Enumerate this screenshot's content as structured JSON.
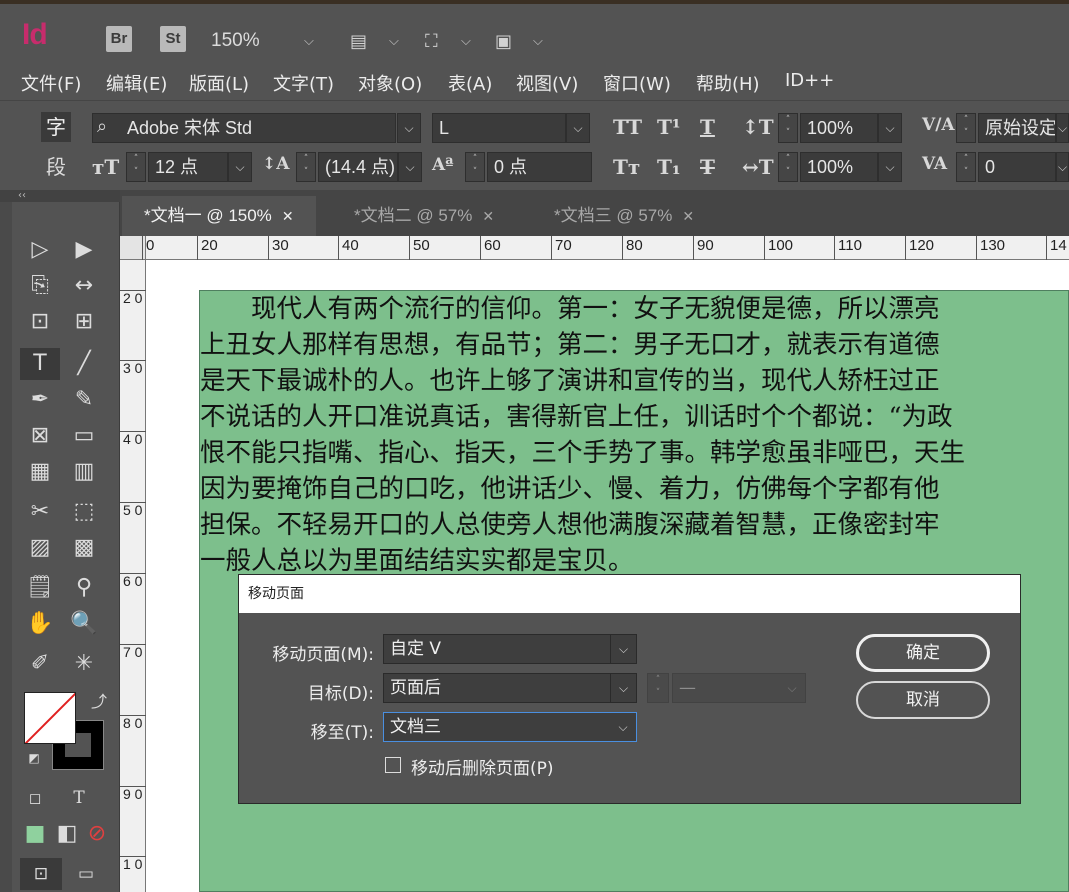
{
  "app": {
    "logo": "Id",
    "bridge_label": "Br",
    "stock_label": "St",
    "zoom": "150%"
  },
  "menubar": {
    "items": [
      "文件(F)",
      "编辑(E)",
      "版面(L)",
      "文字(T)",
      "对象(O)",
      "表(A)",
      "视图(V)",
      "窗口(W)",
      "帮助(H)",
      "ID++"
    ]
  },
  "control_panel": {
    "char_mode": "字",
    "para_mode": "段",
    "font_family": "Adobe 宋体 Std",
    "font_style": "L",
    "font_size": "12 点",
    "leading": "(14.4 点)",
    "tracking": "0 点",
    "vertical_scale": "100%",
    "horizontal_scale": "100%",
    "kerning": "原始设定",
    "baseline_shift": "0"
  },
  "tabs": [
    {
      "label": "*文档一 @ 150%",
      "active": true
    },
    {
      "label": "*文档二 @ 57%",
      "active": false
    },
    {
      "label": "*文档三 @ 57%",
      "active": false
    }
  ],
  "ruler": {
    "h_labels": [
      "0",
      "20",
      "30",
      "40",
      "50",
      "60",
      "70",
      "80",
      "90",
      "100",
      "110",
      "120",
      "130",
      "14"
    ],
    "v_labels": [
      "2 0",
      "3 0",
      "4 0",
      "5 0",
      "6 0",
      "7 0",
      "8 0",
      "9 0",
      "1 0"
    ]
  },
  "document": {
    "lines": [
      "　　现代人有两个流行的信仰。第一：女子无貌便是德，所以漂亮",
      "上丑女人那样有思想，有品节；第二：男子无口才，就表示有道德",
      "是天下最诚朴的人。也许上够了演讲和宣传的当，现代人矫枉过正",
      "不说话的人开口准说真话，害得新官上任，训话时个个都说：“为政",
      "恨不能只指嘴、指心、指天，三个手势了事。韩学愈虽非哑巴，天生",
      "因为要掩饰自己的口吃，他讲话少、慢、着力，仿佛每个字都有他",
      "担保。不轻易开口的人总使旁人想他满腹深藏着智慧，正像密封牢",
      "一般人总以为里面结结实实都是宝贝。"
    ]
  },
  "dialog": {
    "title": "移动页面",
    "move_pages_label": "移动页面(M):",
    "move_pages_value": "自定 V",
    "destination_label": "目标(D):",
    "destination_value": "页面后",
    "destination_page_value": "—",
    "move_to_label": "移至(T):",
    "move_to_value": "文档三",
    "delete_after_label": "移动后删除页面(P)",
    "ok_label": "确定",
    "cancel_label": "取消"
  },
  "colors": {
    "frame_fill": "#7dbf8c",
    "logo": "#c72c6c",
    "focus": "#4a8fe0"
  }
}
